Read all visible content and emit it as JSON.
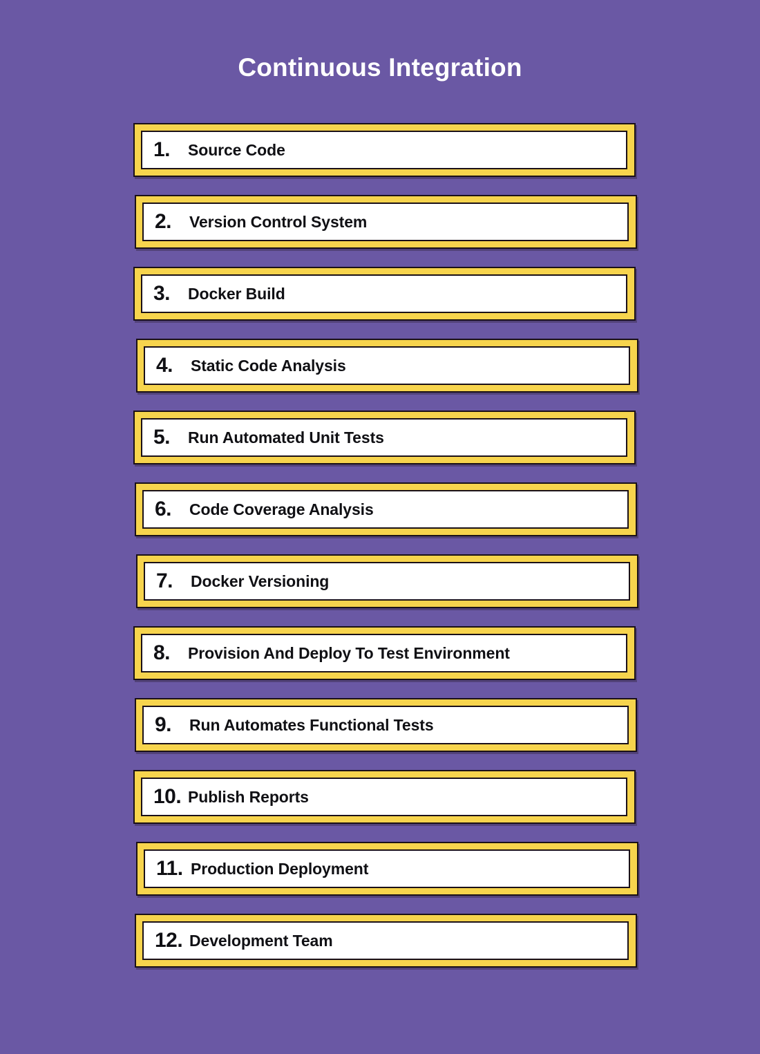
{
  "page": {
    "title": "Continuous Integration",
    "background_color": "#6a58a4",
    "accent_color": "#f7d44d",
    "card_background_color": "#ffffff",
    "border_color": "#1a1018",
    "title_color": "#ffffff",
    "text_color": "#101014"
  },
  "steps": [
    {
      "number": "1.",
      "label": "Source Code"
    },
    {
      "number": "2.",
      "label": "Version Control System"
    },
    {
      "number": "3.",
      "label": "Docker Build"
    },
    {
      "number": "4.",
      "label": "Static Code Analysis"
    },
    {
      "number": "5.",
      "label": "Run Automated Unit Tests"
    },
    {
      "number": "6.",
      "label": "Code Coverage Analysis"
    },
    {
      "number": "7.",
      "label": "Docker Versioning"
    },
    {
      "number": "8.",
      "label": "Provision And Deploy To Test Environment"
    },
    {
      "number": "9.",
      "label": "Run Automates Functional Tests"
    },
    {
      "number": "10.",
      "label": "Publish Reports"
    },
    {
      "number": "11.",
      "label": "Production Deployment"
    },
    {
      "number": "12.",
      "label": "Development Team"
    }
  ]
}
